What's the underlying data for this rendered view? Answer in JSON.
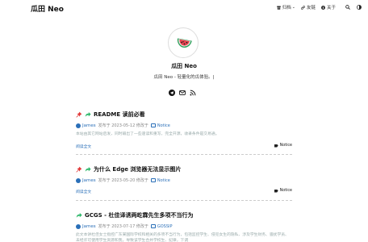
{
  "header": {
    "brand": "瓜田 Neo",
    "nav": [
      {
        "label": "归档",
        "icon": "archive-icon",
        "has_dropdown": true
      },
      {
        "label": "友链",
        "icon": "link-icon"
      },
      {
        "label": "关于",
        "icon": "info-icon"
      }
    ],
    "search_icon": "search-icon",
    "theme_icon": "theme-toggle-icon"
  },
  "profile": {
    "name": "瓜田 Neo",
    "description": "瓜田 Neo - 轻量化的瓜体验。|",
    "social": [
      "telegram-icon",
      "email-icon",
      "rss-icon"
    ]
  },
  "posts": [
    {
      "pinned": true,
      "title": "README 读前必看",
      "author": "James",
      "date_text": "发布于 2023-05-12 修改于",
      "category": "Notice",
      "excerpt": "本站由其它网站启发，同时输出了一些速读和重写，完全开源，收录条件是交易通。",
      "read_more": "阅读全文",
      "tag": "Notice"
    },
    {
      "pinned": true,
      "title": "为什么 Edge 浏览器无法显示图片",
      "author": "James",
      "date_text": "发布于 2023-05-20 修改于",
      "category": "Notice",
      "excerpt": "",
      "read_more": "阅读全文",
      "tag": "Notice"
    },
    {
      "pinned": false,
      "title": "GCGS - 杜佳译诱两屹霖先生多项不当行为",
      "author": "James",
      "date_text": "发布于 2023-07-17 修改于",
      "category": "GOSSIP",
      "excerpt": "此文本讲杜佳女士指控广东某国际学校和相关的多项不当行为，包括监控学生、侵犯女生的隐私、涉及学生财务、骚扰学员、未经许可使用学生资源和我，导致该学生合并学校生、纪律，下调"
    }
  ],
  "colors": {
    "accent": "#2a6fb8",
    "pin": "#e23b3b",
    "share": "#2fb86b"
  }
}
